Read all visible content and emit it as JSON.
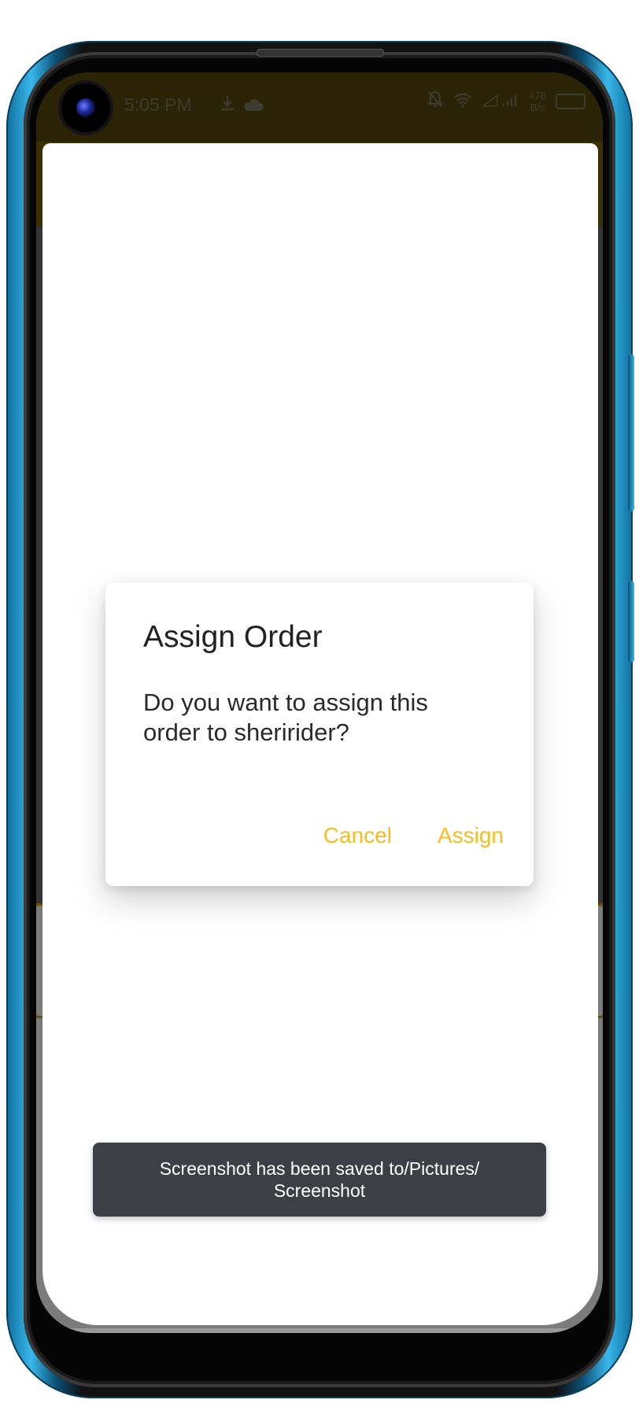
{
  "statusbar": {
    "time": "5:05 PM",
    "net_speed_value": "476",
    "net_speed_unit": "B/s",
    "icons": [
      "download-icon",
      "cloud-icon",
      "mute-bell-icon",
      "wifi-icon",
      "signal-icon",
      "battery-icon"
    ]
  },
  "dialog": {
    "title": "Assign Order",
    "message": "Do you want to assign this order to sheririder?",
    "cancel_label": "Cancel",
    "assign_label": "Assign"
  },
  "toast": {
    "message": "Screenshot has been saved to/Pictures/ Screenshot"
  },
  "colors": {
    "accent": "#f5bd1f",
    "frame": "#39b7ea",
    "toast_bg": "#3c4046"
  }
}
